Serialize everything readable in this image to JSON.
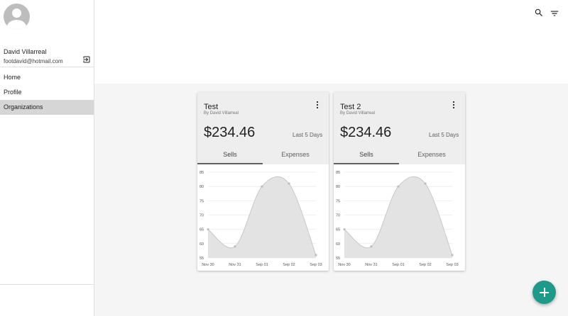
{
  "sidebar": {
    "user": {
      "name": "David Villarreal",
      "email": "footdavid@hotmail.com"
    },
    "nav": [
      {
        "label": "Home"
      },
      {
        "label": "Profile"
      },
      {
        "label": "Organizations",
        "active": true
      }
    ]
  },
  "header": {
    "icons": [
      "search-icon",
      "filter-icon"
    ]
  },
  "cards": [
    {
      "title": "Test",
      "subtitle": "By David Villarreal",
      "amount": "$234.46",
      "range": "Last 5 Days",
      "tabs": [
        "Sells",
        "Expenses"
      ],
      "active_tab": "Sells"
    },
    {
      "title": "Test 2",
      "subtitle": "By David Villarreal",
      "amount": "$234.46",
      "range": "Last 5 Days",
      "tabs": [
        "Sells",
        "Expenses"
      ],
      "active_tab": "Sells"
    }
  ],
  "chart_data": [
    {
      "type": "area",
      "x": [
        "Nov 30",
        "Nov 31",
        "Sep 01",
        "Sep 02",
        "Sep 03"
      ],
      "y": [
        65,
        59,
        80,
        81,
        56
      ],
      "yticks": [
        55,
        60,
        65,
        70,
        75,
        80,
        85
      ],
      "ylim": [
        55,
        85
      ],
      "grid": true
    },
    {
      "type": "area",
      "x": [
        "Nov 30",
        "Nov 31",
        "Sep 01",
        "Sep 02",
        "Sep 03"
      ],
      "y": [
        65,
        59,
        80,
        81,
        56
      ],
      "yticks": [
        55,
        60,
        65,
        70,
        75,
        80,
        85
      ],
      "ylim": [
        55,
        85
      ],
      "grid": true
    }
  ],
  "colors": {
    "fab": "#1e9a8a",
    "active_nav": "#d6d6d6",
    "card_header": "#eeeeee",
    "area_fill": "#e0e0e0",
    "area_line": "#c8c8c8"
  },
  "fab": {
    "icon": "plus-icon"
  }
}
